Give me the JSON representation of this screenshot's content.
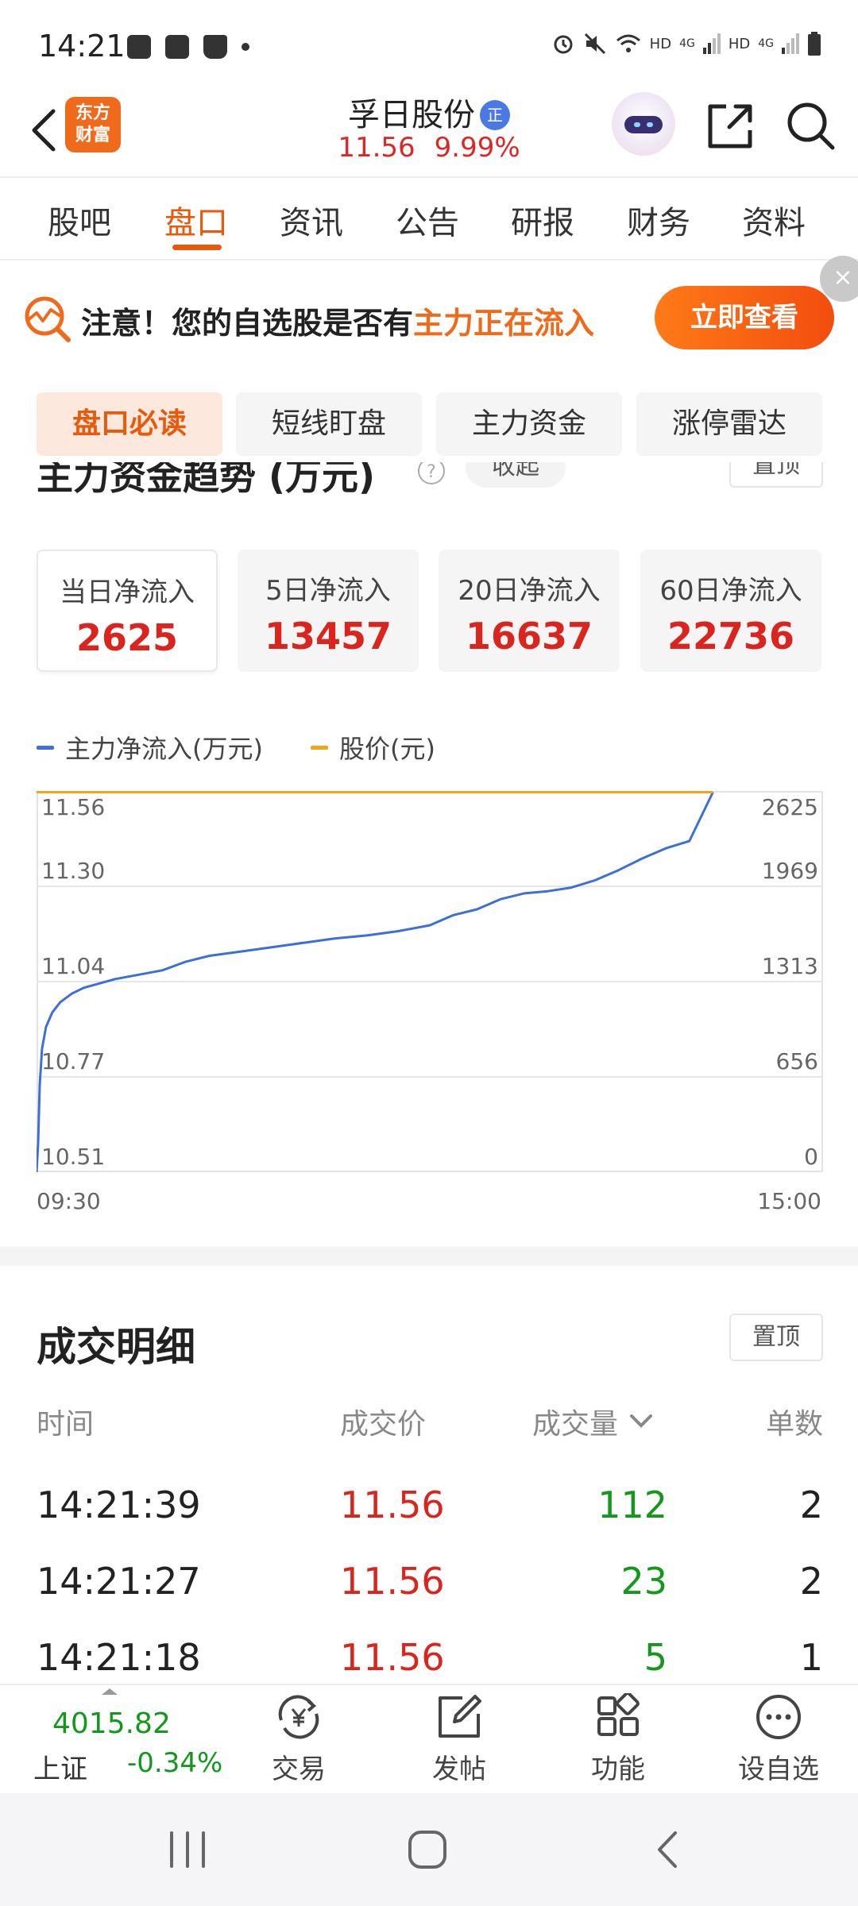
{
  "status_bar": {
    "time": "14:21",
    "network_labels": [
      "HD",
      "4G",
      "HD",
      "4G"
    ]
  },
  "header": {
    "logo_text_line1": "东方",
    "logo_text_line2": "财富",
    "stock_name": "孚日股份",
    "badge": "正",
    "price": "11.56",
    "change_pct": "9.99%"
  },
  "tabs": [
    {
      "label": "股吧",
      "active": false
    },
    {
      "label": "盘口",
      "active": true
    },
    {
      "label": "资讯",
      "active": false
    },
    {
      "label": "公告",
      "active": false
    },
    {
      "label": "研报",
      "active": false
    },
    {
      "label": "财务",
      "active": false
    },
    {
      "label": "资料",
      "active": false
    }
  ],
  "banner": {
    "text_prefix": "注意！您的自选股是否有",
    "text_highlight": "主力正在流入",
    "button": "立即查看",
    "close": "×"
  },
  "subtabs": [
    {
      "label": "盘口必读",
      "active": true
    },
    {
      "label": "短线盯盘",
      "active": false
    },
    {
      "label": "主力资金",
      "active": false
    },
    {
      "label": "涨停雷达",
      "active": false
    }
  ],
  "section": {
    "title": "主力资金趋势 (万元)",
    "help": "?",
    "collapse": "收起",
    "pin": "置顶"
  },
  "flow_cards": [
    {
      "label": "当日净流入",
      "value": "2625",
      "active": true
    },
    {
      "label": "5日净流入",
      "value": "13457",
      "active": false
    },
    {
      "label": "20日净流入",
      "value": "16637",
      "active": false
    },
    {
      "label": "60日净流入",
      "value": "22736",
      "active": false
    }
  ],
  "chart_data": {
    "type": "line",
    "legend_position": "top-left",
    "grid": true,
    "x_ticks": [
      "09:30",
      "15:00"
    ],
    "y_left": {
      "label": "股价(元)",
      "ticks": [
        "11.56",
        "11.30",
        "11.04",
        "10.77",
        "10.51"
      ],
      "range": [
        10.51,
        11.56
      ]
    },
    "y_right": {
      "label": "主力净流入(万元)",
      "ticks": [
        "2625",
        "1969",
        "1313",
        "656",
        "0"
      ],
      "range": [
        0,
        2625
      ]
    },
    "series": [
      {
        "name": "主力净流入(万元)",
        "color": "#3d6fd9",
        "axis": "right",
        "x_frac": [
          0,
          0.002,
          0.004,
          0.007,
          0.012,
          0.02,
          0.03,
          0.045,
          0.06,
          0.08,
          0.1,
          0.13,
          0.16,
          0.19,
          0.22,
          0.26,
          0.3,
          0.34,
          0.38,
          0.42,
          0.46,
          0.5,
          0.53,
          0.56,
          0.59,
          0.62,
          0.65,
          0.68,
          0.71,
          0.74,
          0.77,
          0.8,
          0.83,
          0.86
        ],
        "values": [
          0,
          200,
          600,
          850,
          1000,
          1100,
          1170,
          1230,
          1270,
          1300,
          1330,
          1360,
          1390,
          1450,
          1490,
          1520,
          1550,
          1580,
          1610,
          1630,
          1660,
          1700,
          1770,
          1810,
          1880,
          1920,
          1935,
          1960,
          2010,
          2080,
          2160,
          2230,
          2280,
          2625
        ]
      },
      {
        "name": "股价(元)",
        "color": "#f2a516",
        "axis": "left",
        "x_frac": [
          0,
          0.86
        ],
        "values": [
          11.56,
          11.56
        ]
      }
    ]
  },
  "trade_detail": {
    "title": "成交明细",
    "pin": "置顶",
    "columns": [
      "时间",
      "成交价",
      "成交量",
      "单数"
    ],
    "rows": [
      {
        "time": "14:21:39",
        "price": "11.56",
        "volume": "112",
        "count": "2"
      },
      {
        "time": "14:21:27",
        "price": "11.56",
        "volume": "23",
        "count": "2"
      },
      {
        "time": "14:21:18",
        "price": "11.56",
        "volume": "5",
        "count": "1"
      }
    ]
  },
  "bottom_bar": {
    "index_value": "4015.82",
    "index_name": "上证",
    "index_change": "-0.34%",
    "tools": [
      {
        "label": "交易",
        "icon": "yen-exchange-icon"
      },
      {
        "label": "发帖",
        "icon": "edit-icon"
      },
      {
        "label": "功能",
        "icon": "grid-icon"
      },
      {
        "label": "设自选",
        "icon": "more-icon"
      }
    ]
  },
  "colors": {
    "accent": "#e8590c",
    "up": "#d9251d",
    "down": "#13981b"
  }
}
